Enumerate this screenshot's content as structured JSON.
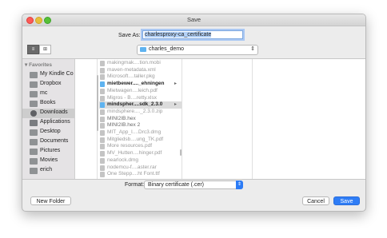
{
  "window": {
    "title": "Save"
  },
  "save_as": {
    "label": "Save As:",
    "value": "charlesproxy-ca_certificate"
  },
  "view": {
    "icon_list": "≡",
    "icon_columns": "⊞"
  },
  "location": {
    "folder": "charles_demo",
    "arrows": "⇕"
  },
  "sidebar": {
    "section": "Favorites",
    "items": [
      {
        "label": "My Kindle Co",
        "icon": "folder"
      },
      {
        "label": "Dropbox",
        "icon": "folder"
      },
      {
        "label": "mc",
        "icon": "folder"
      },
      {
        "label": "Books",
        "icon": "folder"
      },
      {
        "label": "Downloads",
        "icon": "downloads"
      },
      {
        "label": "Applications",
        "icon": "app"
      },
      {
        "label": "Desktop",
        "icon": "folder"
      },
      {
        "label": "Documents",
        "icon": "folder"
      },
      {
        "label": "Pictures",
        "icon": "folder"
      },
      {
        "label": "Movies",
        "icon": "folder"
      },
      {
        "label": "erich",
        "icon": "home"
      }
    ]
  },
  "files": [
    {
      "name": "makingmak....tion.mobi"
    },
    {
      "name": "maven-metadata.xml"
    },
    {
      "name": "Microsoft....taller.pkg"
    },
    {
      "name": "mietbewer...._ehningen"
    },
    {
      "name": "Mietwagen....leich.pdf"
    },
    {
      "name": "Migros - B....retty.xlsx"
    },
    {
      "name": "mindspher....sdk_2.3.0"
    },
    {
      "name": "mindsphere...._2.3.0.zip"
    },
    {
      "name": "MINI2IB.hex"
    },
    {
      "name": "MINI2IB.hex 2"
    },
    {
      "name": "MIT_App_I....Drc3.dmg"
    },
    {
      "name": "Mitgliedsb....ung_TK.pdf"
    },
    {
      "name": "More resources.pdf"
    },
    {
      "name": "MV_Hutten....hinger.pdf"
    },
    {
      "name": "nearlock.dmg"
    },
    {
      "name": "nodemcu-f....aster.rar"
    },
    {
      "name": "One Stepp....ht Font.ttf"
    }
  ],
  "format": {
    "label": "Format:",
    "value": "Binary certificate (.cer)",
    "arrows": "⇕"
  },
  "buttons": {
    "new_folder": "New Folder",
    "cancel": "Cancel",
    "save": "Save"
  }
}
